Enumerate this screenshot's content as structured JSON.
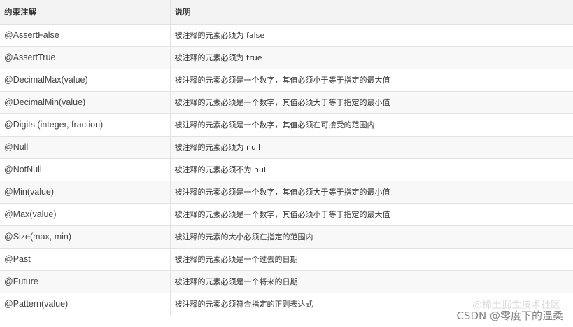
{
  "table": {
    "headers": [
      "约束注解",
      "说明"
    ],
    "rows": [
      {
        "annotation": "@AssertFalse",
        "description": "被注释的元素必须为 false"
      },
      {
        "annotation": "@AssertTrue",
        "description": "被注释的元素必须为 true"
      },
      {
        "annotation": "@DecimalMax(value)",
        "description": "被注释的元素必须是一个数字，其值必须小于等于指定的最大值"
      },
      {
        "annotation": "@DecimalMin(value)",
        "description": "被注释的元素必须是一个数字，其值必须大于等于指定的最小值"
      },
      {
        "annotation": "@Digits (integer, fraction)",
        "description": "被注释的元素必须是一个数字，其值必须在可接受的范围内"
      },
      {
        "annotation": "@Null",
        "description": "被注释的元素必须为 null"
      },
      {
        "annotation": "@NotNull",
        "description": "被注释的元素必须不为 null"
      },
      {
        "annotation": "@Min(value)",
        "description": "被注释的元素必须是一个数字，其值必须大于等于指定的最小值"
      },
      {
        "annotation": "@Max(value)",
        "description": "被注释的元素必须是一个数字，其值必须小于等于指定的最大值"
      },
      {
        "annotation": "@Size(max, min)",
        "description": "被注释的元素的大小必须在指定的范围内"
      },
      {
        "annotation": "@Past",
        "description": "被注释的元素必须是一个过去的日期"
      },
      {
        "annotation": "@Future",
        "description": "被注释的元素必须是一个将来的日期"
      },
      {
        "annotation": "@Pattern(value)",
        "description": "被注释的元素必须符合指定的正则表达式"
      }
    ]
  },
  "watermark": {
    "text": "CSDN @零度下的温柔",
    "ghost_text": "@稀土掘金技术社区"
  }
}
